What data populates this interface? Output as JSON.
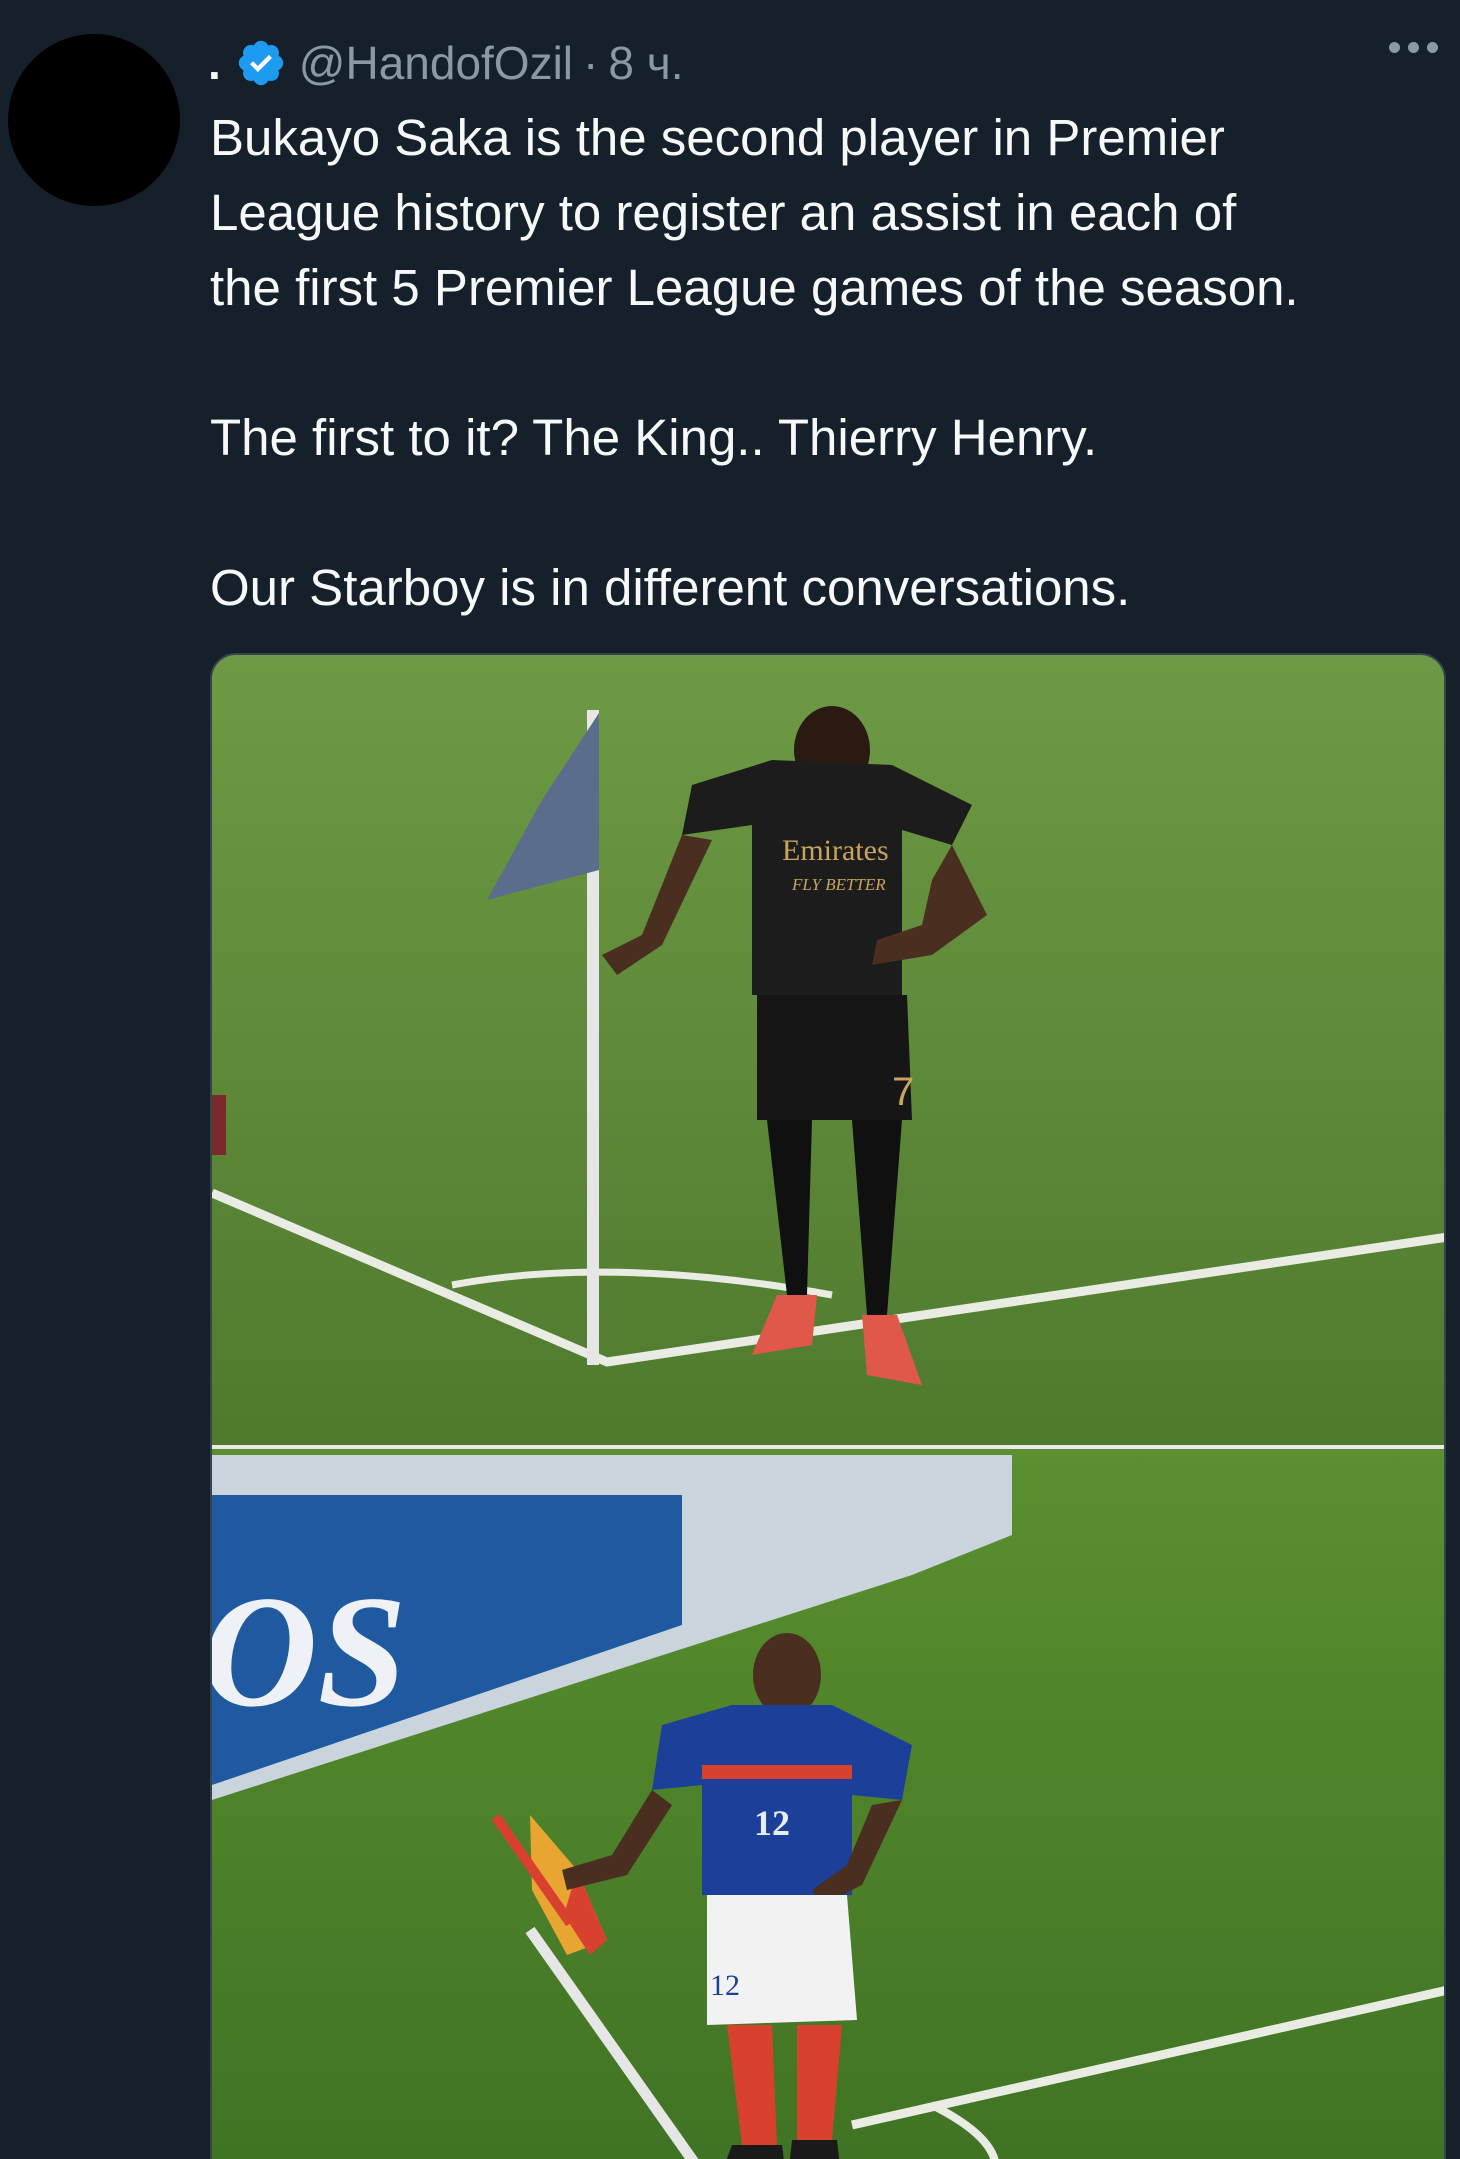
{
  "tweet": {
    "display_name": ".",
    "handle": "@HandofOzil",
    "separator": "·",
    "time": "8 ч.",
    "text_lines": [
      "Bukayo Saka is the second player in Premier",
      "League history to register an assist in each of",
      "the first 5 Premier League games of the season.",
      "The first to it? The King.. Thierry Henry.",
      "Our Starboy is in different conversations."
    ]
  },
  "media": {
    "top_photo": {
      "shirt_sponsor": "Emirates",
      "shirt_slogan": "FLY BETTER",
      "shirt_number": "7"
    },
    "bottom_photo": {
      "shirt_number": "12",
      "shorts_number": "12",
      "board_text": "OS"
    }
  },
  "colors": {
    "background": "#15202b",
    "verified_badge": "#1d9bf0",
    "secondary_text": "#8b98a5",
    "primary_text": "#f7f9f9"
  },
  "icons": [
    "avatar",
    "verified-badge-icon",
    "more-options-icon"
  ]
}
